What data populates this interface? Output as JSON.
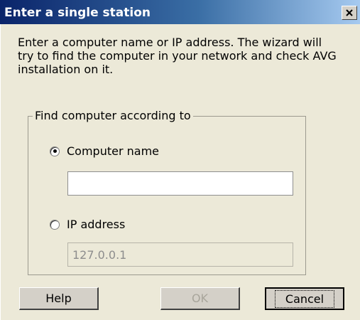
{
  "window": {
    "title": "Enter a single station"
  },
  "instructions": "Enter a computer name or IP address. The wizard will try to find the computer in your network and check AVG installation on it.",
  "group": {
    "legend": "Find computer according to",
    "computer_name": {
      "label": "Computer name",
      "selected": true,
      "value": ""
    },
    "ip_address": {
      "label": "IP address",
      "selected": false,
      "value": "127.0.0.1"
    }
  },
  "buttons": {
    "help": "Help",
    "ok": "OK",
    "cancel": "Cancel"
  }
}
